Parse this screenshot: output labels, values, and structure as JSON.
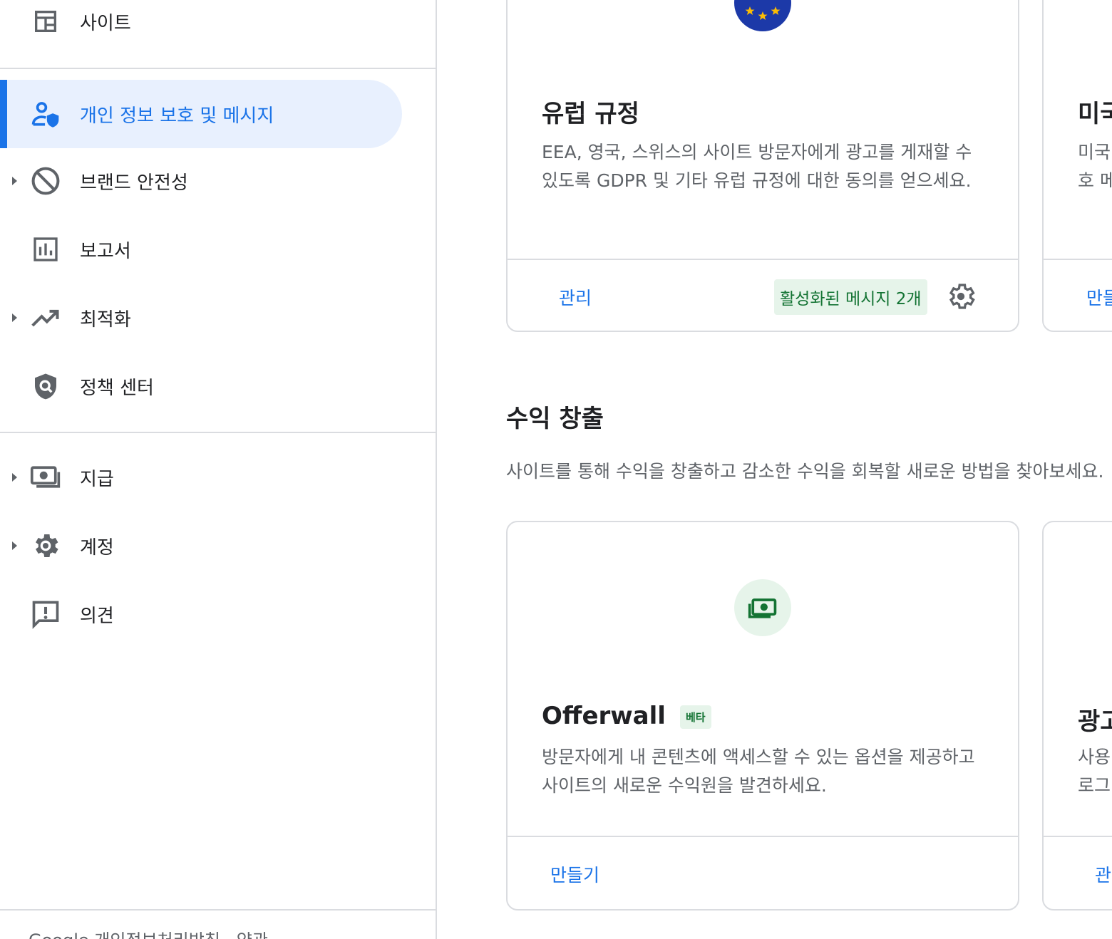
{
  "sidebar": {
    "items": [
      {
        "label": "사이트",
        "icon": "sites-icon"
      },
      {
        "label": "개인 정보 보호 및 메시지",
        "icon": "privacy-icon",
        "active": true
      },
      {
        "label": "브랜드 안전성",
        "icon": "block-icon"
      },
      {
        "label": "보고서",
        "icon": "reports-icon"
      },
      {
        "label": "최적화",
        "icon": "trending-up-icon"
      },
      {
        "label": "정책 센터",
        "icon": "policy-shield-icon"
      },
      {
        "label": "지급",
        "icon": "payments-icon"
      },
      {
        "label": "계정",
        "icon": "gear-icon"
      },
      {
        "label": "의견",
        "icon": "feedback-icon"
      }
    ],
    "footer": "Google   개인정보처리방침 · 약관"
  },
  "cards": {
    "eu": {
      "title": "유럽 규정",
      "description": "EEA, 영국, 스위스의 사이트 방문자에게 광고를 게재할 수 있도록 GDPR 및 기타 유럽 규정에 대한 동의를 얻으세요.",
      "manage_label": "관리",
      "status": "활성화된 메시지 2개"
    },
    "us_partial": {
      "title": "미국",
      "description_line1": "미국",
      "description_line2": "호 메",
      "action_label": "만들"
    },
    "offerwall": {
      "title": "Offerwall",
      "badge": "베타",
      "description": "방문자에게 내 콘텐츠에 액세스할 수 있는 옵션을 제공하고 사이트의 새로운 수익원을 발견하세요.",
      "create_label": "만들기"
    },
    "ad_partial": {
      "title": "광고",
      "description_line1": "사용",
      "description_line2": "로그",
      "action_label": "관"
    }
  },
  "monetization": {
    "title": "수익 창출",
    "description": "사이트를 통해 수익을 창출하고 감소한 수익을 회복할 새로운 방법을 찾아보세요."
  },
  "colors": {
    "accent": "#1a73e8",
    "active_bg": "#e8f0fe",
    "success_bg": "#e6f4ea",
    "success_text": "#137333",
    "eu_blue": "#1c39a8",
    "eu_star": "#fbbc04"
  }
}
